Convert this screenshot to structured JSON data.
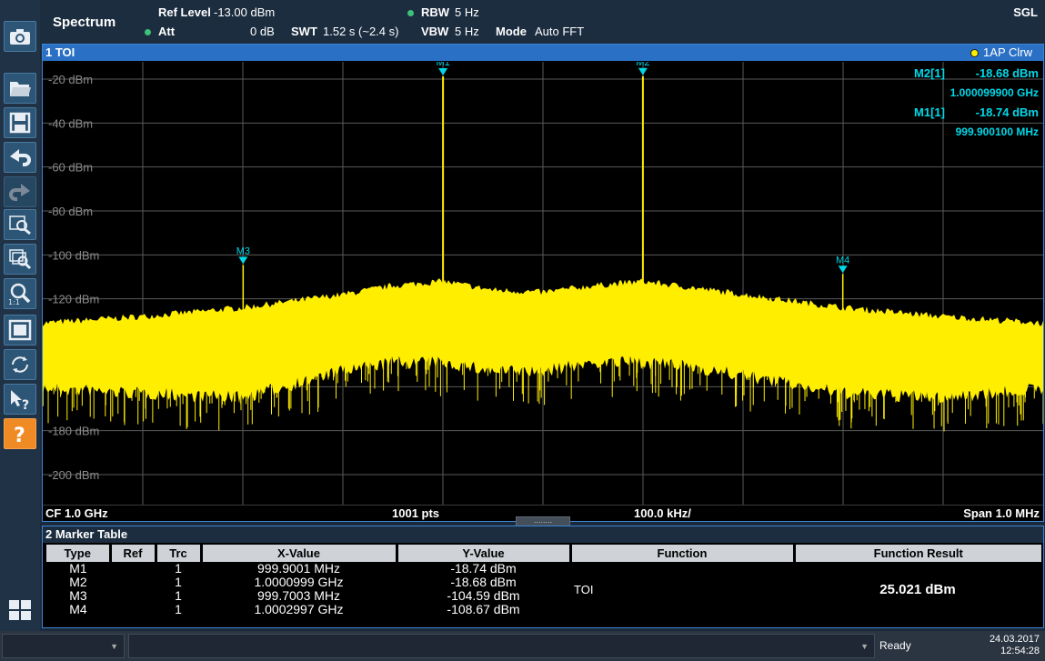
{
  "header": {
    "mode": "Spectrum",
    "ref_level_label": "Ref Level",
    "ref_level_value": "-13.00 dBm",
    "att_label": "Att",
    "att_value": "0 dB",
    "swt_label": "SWT",
    "swt_value": "1.52 s (~2.4 s)",
    "rbw_label": "RBW",
    "rbw_value": "5 Hz",
    "vbw_label": "VBW",
    "vbw_value": "5 Hz",
    "fft_label": "Mode",
    "fft_value": "Auto FFT",
    "sweep_mode": "SGL",
    "status_dot_color": "#3ec27a"
  },
  "toolbar": {
    "icons": [
      "camera-icon",
      "open-folder-icon",
      "save-icon",
      "undo-icon",
      "redo-icon",
      "zoom-icon",
      "multi-zoom-icon",
      "zoom-1-1-icon",
      "full-screen-icon",
      "sweep-icon",
      "help-pointer-icon",
      "help-icon",
      "windows-icon"
    ]
  },
  "diagram": {
    "title": "1 TOI",
    "trace_label": "1AP Clrw",
    "trace_color": "#ffee00",
    "marker_color": "#00d8e8",
    "markers": [
      {
        "name": "M1",
        "x_mhz": 999.9001,
        "y_dbm": -18.74
      },
      {
        "name": "M2",
        "x_mhz": 1000.0999,
        "y_dbm": -18.68
      },
      {
        "name": "M3",
        "x_mhz": 999.7003,
        "y_dbm": -104.59
      },
      {
        "name": "M4",
        "x_mhz": 1000.2997,
        "y_dbm": -108.67
      }
    ],
    "marker_info": [
      {
        "label": "M2[1]",
        "value": "-18.68 dBm",
        "freq": "1.000099900 GHz"
      },
      {
        "label": "M1[1]",
        "value": "-18.74 dBm",
        "freq": "999.900100 MHz"
      }
    ],
    "footer": {
      "cf": "CF 1.0 GHz",
      "pts": "1001 pts",
      "div": "100.0 kHz/",
      "span": "Span 1.0 MHz"
    }
  },
  "chart_data": {
    "type": "line",
    "title": "1 TOI",
    "x_unit": "MHz",
    "xlim": [
      999.5,
      1000.5
    ],
    "ylim": [
      -210,
      -10
    ],
    "y_ticks": [
      -20,
      -40,
      -60,
      -80,
      -100,
      -120,
      -140,
      -160,
      -180,
      -200
    ],
    "y_tick_labels": [
      "-20 dBm",
      "-40 dBm",
      "-60 dBm",
      "-80 dBm",
      "-100 dBm",
      "-120 dBm",
      "",
      "",
      "-180 dBm",
      "-200 dBm"
    ],
    "grid": true,
    "series": [
      {
        "name": "1AP Clrw",
        "x": [
          999.5,
          999.6,
          999.7,
          999.8,
          999.85,
          999.9,
          999.95,
          1000.0,
          1000.05,
          1000.1,
          1000.15,
          1000.2,
          1000.3,
          1000.4,
          1000.5
        ],
        "y_top": [
          -131,
          -128,
          -124,
          -118,
          -114,
          -112,
          -116,
          -117,
          -114,
          -112,
          -115,
          -118,
          -124,
          -128,
          -131
        ],
        "y_bottom": [
          -158,
          -160,
          -162,
          -150,
          -146,
          -146,
          -150,
          -150,
          -146,
          -146,
          -148,
          -152,
          -160,
          -162,
          -158
        ]
      }
    ],
    "tones": [
      {
        "x": 999.9001,
        "y": -18.74
      },
      {
        "x": 1000.0999,
        "y": -18.68
      }
    ],
    "spurs": [
      {
        "x": 999.7003,
        "y": -104.59
      },
      {
        "x": 1000.2997,
        "y": -108.67
      }
    ]
  },
  "marker_table": {
    "title": "2 Marker Table",
    "columns": [
      "Type",
      "Ref",
      "Trc",
      "X-Value",
      "Y-Value",
      "Function",
      "Function Result"
    ],
    "rows": [
      {
        "type": "M1",
        "ref": "",
        "trc": "1",
        "x": "999.9001 MHz",
        "y": "-18.74 dBm"
      },
      {
        "type": "M2",
        "ref": "",
        "trc": "1",
        "x": "1.0000999 GHz",
        "y": "-18.68 dBm"
      },
      {
        "type": "M3",
        "ref": "",
        "trc": "1",
        "x": "999.7003 MHz",
        "y": "-104.59 dBm"
      },
      {
        "type": "M4",
        "ref": "",
        "trc": "1",
        "x": "1.0002997 GHz",
        "y": "-108.67 dBm"
      }
    ],
    "function": "TOI",
    "function_result": "25.021 dBm"
  },
  "statusbar": {
    "status": "Ready",
    "date": "24.03.2017",
    "time": "12:54:28"
  }
}
